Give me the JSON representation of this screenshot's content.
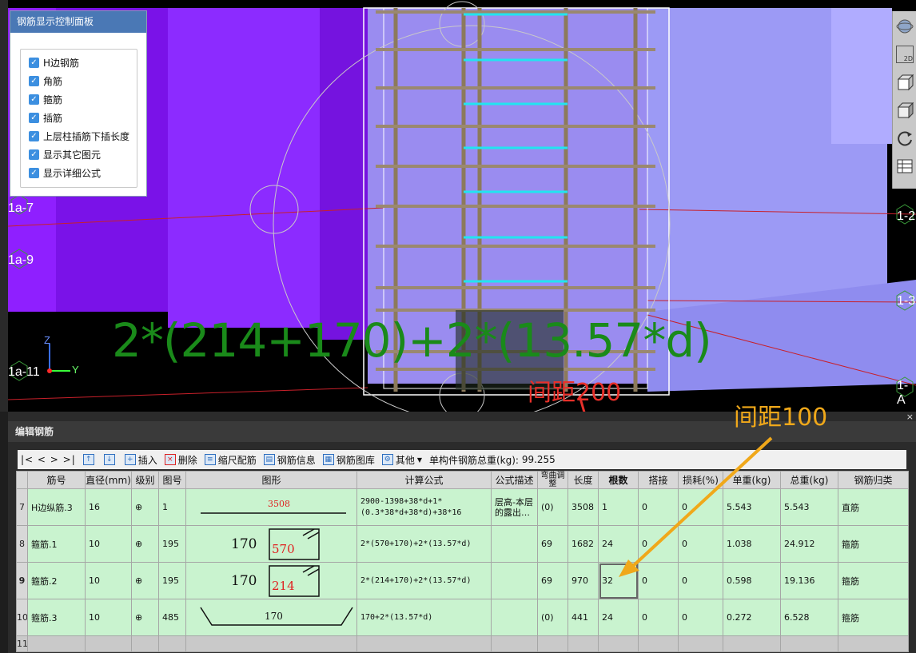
{
  "control_panel": {
    "title": "钢筋显示控制面板",
    "options": [
      {
        "label": "H边钢筋",
        "checked": true
      },
      {
        "label": "角筋",
        "checked": true
      },
      {
        "label": "箍筋",
        "checked": true
      },
      {
        "label": "插筋",
        "checked": true
      },
      {
        "label": "上层柱插筋下插长度",
        "checked": true
      },
      {
        "label": "显示其它图元",
        "checked": true
      },
      {
        "label": "显示详细公式",
        "checked": true
      }
    ]
  },
  "axis_labels": {
    "left": [
      "1a-7",
      "1a-9",
      "1a-11"
    ],
    "right": [
      "1-2",
      "1-3",
      "1-A"
    ]
  },
  "gizmo": {
    "z": "Z",
    "y": "Y"
  },
  "view_toolbar": {
    "btn_2d": "2D"
  },
  "overlay": {
    "formula": "2*(214+170)+2*(13.57*d)",
    "spacing_200": "间距200",
    "spacing_100": "间距100"
  },
  "editor": {
    "title": "编辑钢筋",
    "close": "×",
    "toolbar": {
      "nav": "|<  <  >  >|",
      "insert": "插入",
      "delete": "删除",
      "scale": "缩尺配筋",
      "info": "钢筋信息",
      "library": "钢筋图库",
      "other": "其他",
      "total_label": "单构件钢筋总重(kg):",
      "total_value": "99.255"
    },
    "columns": [
      "筋号",
      "直径(mm)",
      "级别",
      "图号",
      "图形",
      "计算公式",
      "公式描述",
      "弯曲调整",
      "长度",
      "根数",
      "搭接",
      "损耗(%)",
      "单重(kg)",
      "总重(kg)",
      "钢筋归类"
    ],
    "rows": [
      {
        "num": "7",
        "name": "H边纵筋.3",
        "dia": "16",
        "grade": "⊕",
        "fig": "1",
        "shape_a": "3508",
        "shape_b": "",
        "formula": "2900-1398+38*d+1*(0.3*38*d+38*d)+38*16",
        "desc": "层高-本层的露出…",
        "bend": "(0)",
        "length": "3508",
        "count": "1",
        "lap": "0",
        "loss": "0",
        "unit_w": "5.543",
        "total_w": "5.543",
        "category": "直筋"
      },
      {
        "num": "8",
        "name": "箍筋.1",
        "dia": "10",
        "grade": "⊕",
        "fig": "195",
        "shape_a": "170",
        "shape_b": "570",
        "formula": "2*(570+170)+2*(13.57*d)",
        "desc": "",
        "bend": "69",
        "length": "1682",
        "count": "24",
        "lap": "0",
        "loss": "0",
        "unit_w": "1.038",
        "total_w": "24.912",
        "category": "箍筋"
      },
      {
        "num": "9",
        "name": "箍筋.2",
        "dia": "10",
        "grade": "⊕",
        "fig": "195",
        "shape_a": "170",
        "shape_b": "214",
        "formula": "2*(214+170)+2*(13.57*d)",
        "desc": "",
        "bend": "69",
        "length": "970",
        "count": "32",
        "lap": "0",
        "loss": "0",
        "unit_w": "0.598",
        "total_w": "19.136",
        "category": "箍筋"
      },
      {
        "num": "10",
        "name": "箍筋.3",
        "dia": "10",
        "grade": "⊕",
        "fig": "485",
        "shape_a": "170",
        "shape_b": "",
        "formula": "170+2*(13.57*d)",
        "desc": "",
        "bend": "(0)",
        "length": "441",
        "count": "24",
        "lap": "0",
        "loss": "0",
        "unit_w": "0.272",
        "total_w": "6.528",
        "category": "箍筋"
      }
    ],
    "empty_row_num": "11"
  }
}
